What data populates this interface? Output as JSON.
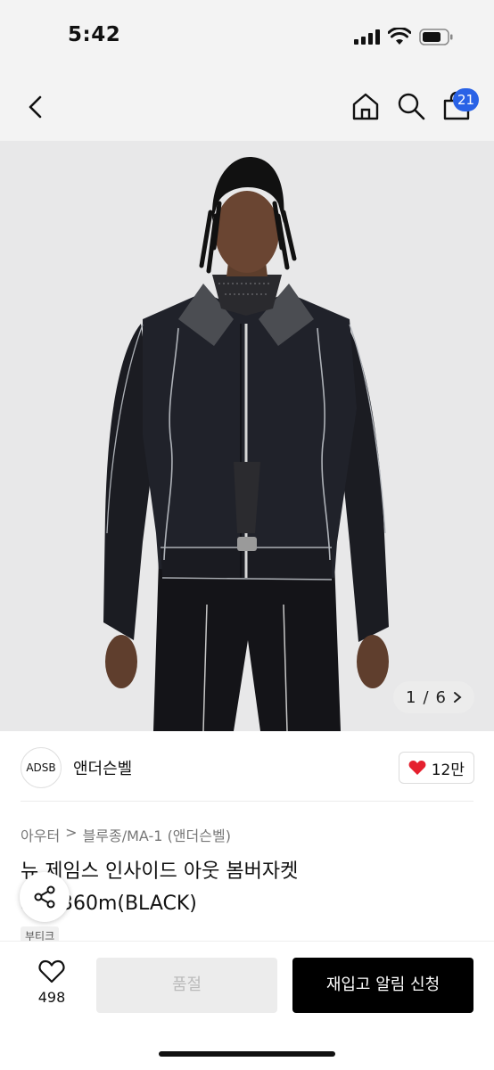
{
  "status_bar": {
    "time": "5:42"
  },
  "nav": {
    "cart_count": "21"
  },
  "gallery": {
    "current": "1",
    "separator": "/",
    "total": "6"
  },
  "brand": {
    "logo_text": "ADSB",
    "name": "앤더슨벨",
    "likes": "12만"
  },
  "breadcrumb": {
    "category": "아우터",
    "separator": ">",
    "subcategory": "블루종/MA-1 (앤더슨벨)"
  },
  "product": {
    "title": "뉴 제임스 인사이드 아웃 봄버자켓 awa360m(BLACK)",
    "tag": "부티크"
  },
  "bottom_bar": {
    "wish_count": "498",
    "soldout_label": "품절",
    "restock_label": "재입고 알림 신청"
  },
  "colors": {
    "accent_blue": "#2962e6",
    "heart_red": "#e5202e",
    "primary_black": "#000000"
  }
}
